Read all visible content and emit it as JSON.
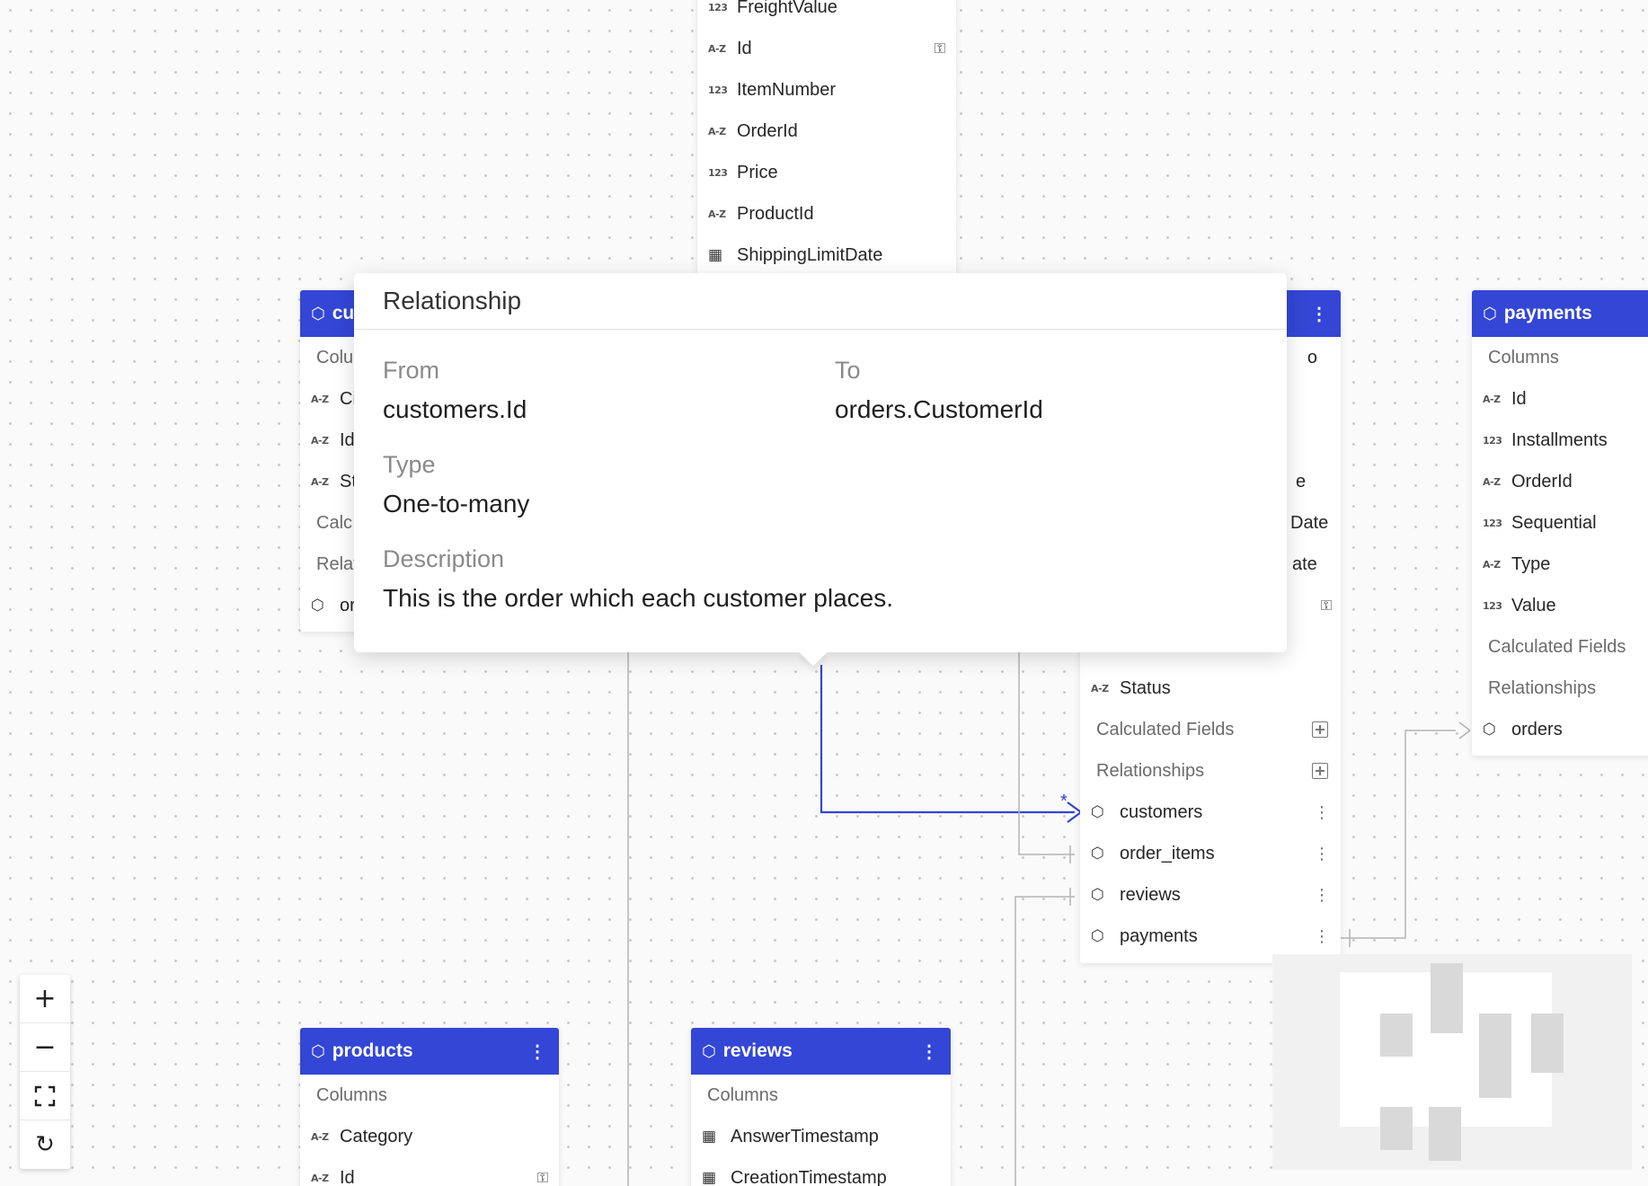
{
  "tables": {
    "order_items": {
      "rows": [
        {
          "type": "123",
          "name": "FreightValue",
          "key": false
        },
        {
          "type": "A-Z",
          "name": "Id",
          "key": true
        },
        {
          "type": "123",
          "name": "ItemNumber",
          "key": false
        },
        {
          "type": "A-Z",
          "name": "OrderId",
          "key": false
        },
        {
          "type": "123",
          "name": "Price",
          "key": false
        },
        {
          "type": "A-Z",
          "name": "ProductId",
          "key": false
        },
        {
          "type": "date",
          "name": "ShippingLimitDate",
          "key": false
        }
      ]
    },
    "customers": {
      "title_visible": "cu",
      "columns_label": "Colu",
      "rows": [
        {
          "type": "A-Z",
          "name": "Ci"
        },
        {
          "type": "A-Z",
          "name": "Id"
        },
        {
          "type": "A-Z",
          "name": "St"
        }
      ],
      "calc_label": "Calc",
      "rel_label": "Relat",
      "rel_rows": [
        {
          "name": "or"
        }
      ]
    },
    "orders": {
      "partial_rows": [
        {
          "text": "o"
        },
        {
          "text": "e"
        },
        {
          "text": "Date"
        },
        {
          "text": "ate"
        }
      ],
      "status_row": {
        "type": "A-Z",
        "name": "Status"
      },
      "calc_label": "Calculated Fields",
      "rel_label": "Relationships",
      "relationships": [
        "customers",
        "order_items",
        "reviews",
        "payments"
      ]
    },
    "payments": {
      "title": "payments",
      "columns_label": "Columns",
      "rows": [
        {
          "type": "A-Z",
          "name": "Id"
        },
        {
          "type": "123",
          "name": "Installments"
        },
        {
          "type": "A-Z",
          "name": "OrderId"
        },
        {
          "type": "123",
          "name": "Sequential"
        },
        {
          "type": "A-Z",
          "name": "Type"
        },
        {
          "type": "123",
          "name": "Value"
        }
      ],
      "calc_label": "Calculated Fields",
      "rel_label": "Relationships",
      "relationships": [
        "orders"
      ]
    },
    "products": {
      "title": "products",
      "columns_label": "Columns",
      "rows": [
        {
          "type": "A-Z",
          "name": "Category",
          "key": false
        },
        {
          "type": "A-Z",
          "name": "Id",
          "key": true
        }
      ]
    },
    "reviews": {
      "title": "reviews",
      "columns_label": "Columns",
      "rows": [
        {
          "type": "date",
          "name": "AnswerTimestamp"
        },
        {
          "type": "date",
          "name": "CreationTimestamp"
        }
      ]
    }
  },
  "popover": {
    "title": "Relationship",
    "from_label": "From",
    "from_value": "customers.Id",
    "to_label": "To",
    "to_value": "orders.CustomerId",
    "type_label": "Type",
    "type_value": "One-to-many",
    "description_label": "Description",
    "description_value": "This is the order which each customer places."
  },
  "edge_marker": "*",
  "icons": {
    "model": "cube-icon",
    "key": "key-icon",
    "menu": "more-vertical-icon",
    "add": "plus-square-icon",
    "zoom_in": "plus-icon",
    "zoom_out": "minus-icon",
    "fit": "fit-view-icon",
    "refresh": "refresh-icon"
  },
  "colors": {
    "accent": "#3346d6",
    "edge_active": "#3346d6",
    "edge": "#b3b3b3"
  }
}
